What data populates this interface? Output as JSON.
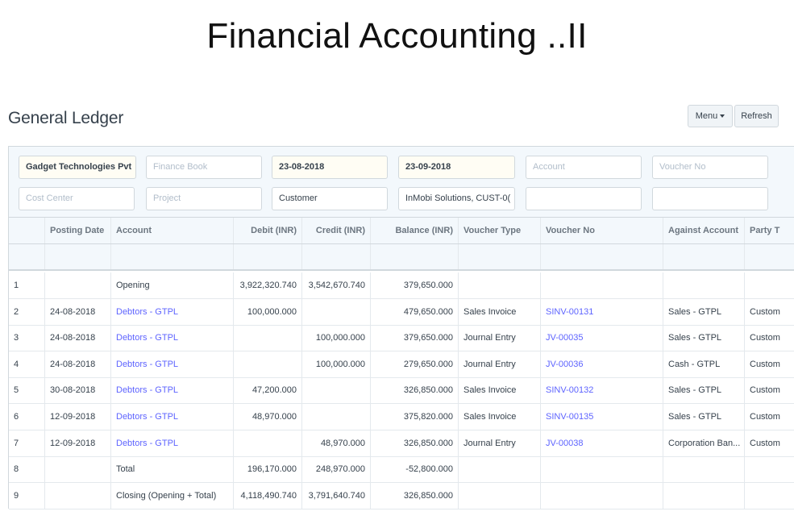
{
  "slide": {
    "title": "Financial Accounting ..II"
  },
  "page": {
    "title": "General Ledger",
    "menu_label": "Menu",
    "refresh_label": "Refresh"
  },
  "filters": {
    "company": "Gadget Technologies Pvt",
    "finance_book_placeholder": "Finance Book",
    "from_date": "23-08-2018",
    "to_date": "23-09-2018",
    "account_placeholder": "Account",
    "voucher_no_placeholder": "Voucher No",
    "cost_center_placeholder": "Cost Center",
    "project_placeholder": "Project",
    "party_type": "Customer",
    "party": "InMobi Solutions, CUST-0(",
    "extra_1": "",
    "extra_2": ""
  },
  "table": {
    "columns": [
      "",
      "Posting Date",
      "Account",
      "Debit (INR)",
      "Credit (INR)",
      "Balance (INR)",
      "Voucher Type",
      "Voucher No",
      "Against Account",
      "Party T"
    ],
    "rows": [
      {
        "idx": "1",
        "date": "",
        "account": "Opening",
        "debit": "3,922,320.740",
        "credit": "3,542,670.740",
        "balance": "379,650.000",
        "vtype": "",
        "vno": "",
        "against": "",
        "party": ""
      },
      {
        "idx": "2",
        "date": "24-08-2018",
        "account": "Debtors - GTPL",
        "debit": "100,000.000",
        "credit": "",
        "balance": "479,650.000",
        "vtype": "Sales Invoice",
        "vno": "SINV-00131",
        "against": "Sales - GTPL",
        "party": "Custom"
      },
      {
        "idx": "3",
        "date": "24-08-2018",
        "account": "Debtors - GTPL",
        "debit": "",
        "credit": "100,000.000",
        "balance": "379,650.000",
        "vtype": "Journal Entry",
        "vno": "JV-00035",
        "against": "Sales - GTPL",
        "party": "Custom"
      },
      {
        "idx": "4",
        "date": "24-08-2018",
        "account": "Debtors - GTPL",
        "debit": "",
        "credit": "100,000.000",
        "balance": "279,650.000",
        "vtype": "Journal Entry",
        "vno": "JV-00036",
        "against": "Cash - GTPL",
        "party": "Custom"
      },
      {
        "idx": "5",
        "date": "30-08-2018",
        "account": "Debtors - GTPL",
        "debit": "47,200.000",
        "credit": "",
        "balance": "326,850.000",
        "vtype": "Sales Invoice",
        "vno": "SINV-00132",
        "against": "Sales - GTPL",
        "party": "Custom"
      },
      {
        "idx": "6",
        "date": "12-09-2018",
        "account": "Debtors - GTPL",
        "debit": "48,970.000",
        "credit": "",
        "balance": "375,820.000",
        "vtype": "Sales Invoice",
        "vno": "SINV-00135",
        "against": "Sales - GTPL",
        "party": "Custom"
      },
      {
        "idx": "7",
        "date": "12-09-2018",
        "account": "Debtors - GTPL",
        "debit": "",
        "credit": "48,970.000",
        "balance": "326,850.000",
        "vtype": "Journal Entry",
        "vno": "JV-00038",
        "against": "Corporation Ban...",
        "party": "Custom"
      },
      {
        "idx": "8",
        "date": "",
        "account": "Total",
        "debit": "196,170.000",
        "credit": "248,970.000",
        "balance": "-52,800.000",
        "vtype": "",
        "vno": "",
        "against": "",
        "party": ""
      },
      {
        "idx": "9",
        "date": "",
        "account": "Closing (Opening + Total)",
        "debit": "4,118,490.740",
        "credit": "3,791,640.740",
        "balance": "326,850.000",
        "vtype": "",
        "vno": "",
        "against": "",
        "party": ""
      }
    ]
  },
  "colors": {
    "link": "#5e64ff",
    "header_bg": "#f3f8fc",
    "border": "#d1d8dd"
  }
}
